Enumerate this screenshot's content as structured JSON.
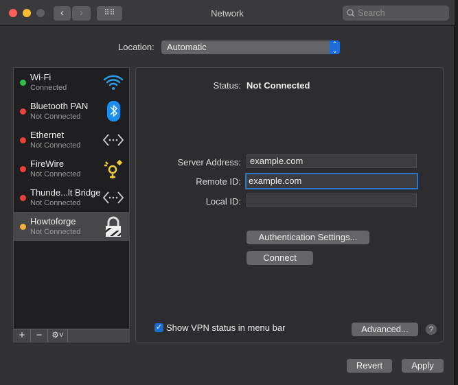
{
  "window": {
    "title": "Network",
    "search_placeholder": "Search"
  },
  "location": {
    "label": "Location:",
    "value": "Automatic"
  },
  "services": [
    {
      "name": "Wi-Fi",
      "status": "Connected",
      "dot": "#2ec04a",
      "icon": "wifi-icon"
    },
    {
      "name": "Bluetooth PAN",
      "status": "Not Connected",
      "dot": "#f0403c",
      "icon": "bluetooth-icon"
    },
    {
      "name": "Ethernet",
      "status": "Not Connected",
      "dot": "#f0403c",
      "icon": "ethernet-icon"
    },
    {
      "name": "FireWire",
      "status": "Not Connected",
      "dot": "#f0403c",
      "icon": "firewire-icon"
    },
    {
      "name": "Thunde...lt Bridge",
      "status": "Not Connected",
      "dot": "#f0403c",
      "icon": "thunderbolt-bridge-icon"
    },
    {
      "name": "Howtoforge",
      "status": "Not Connected",
      "dot": "#f5b13a",
      "icon": "vpn-lock-icon"
    }
  ],
  "sidebar_buttons": {
    "add": "+",
    "remove": "−"
  },
  "detail": {
    "status_label": "Status:",
    "status_value": "Not Connected",
    "server_label": "Server Address:",
    "server_value": "example.com",
    "remote_label": "Remote ID:",
    "remote_value": "example.com",
    "local_label": "Local ID:",
    "local_value": "",
    "auth_button": "Authentication Settings...",
    "connect_button": "Connect",
    "show_vpn_label": "Show VPN status in menu bar",
    "show_vpn_checked": true,
    "advanced_button": "Advanced...",
    "help": "?"
  },
  "footer": {
    "revert": "Revert",
    "apply": "Apply"
  }
}
